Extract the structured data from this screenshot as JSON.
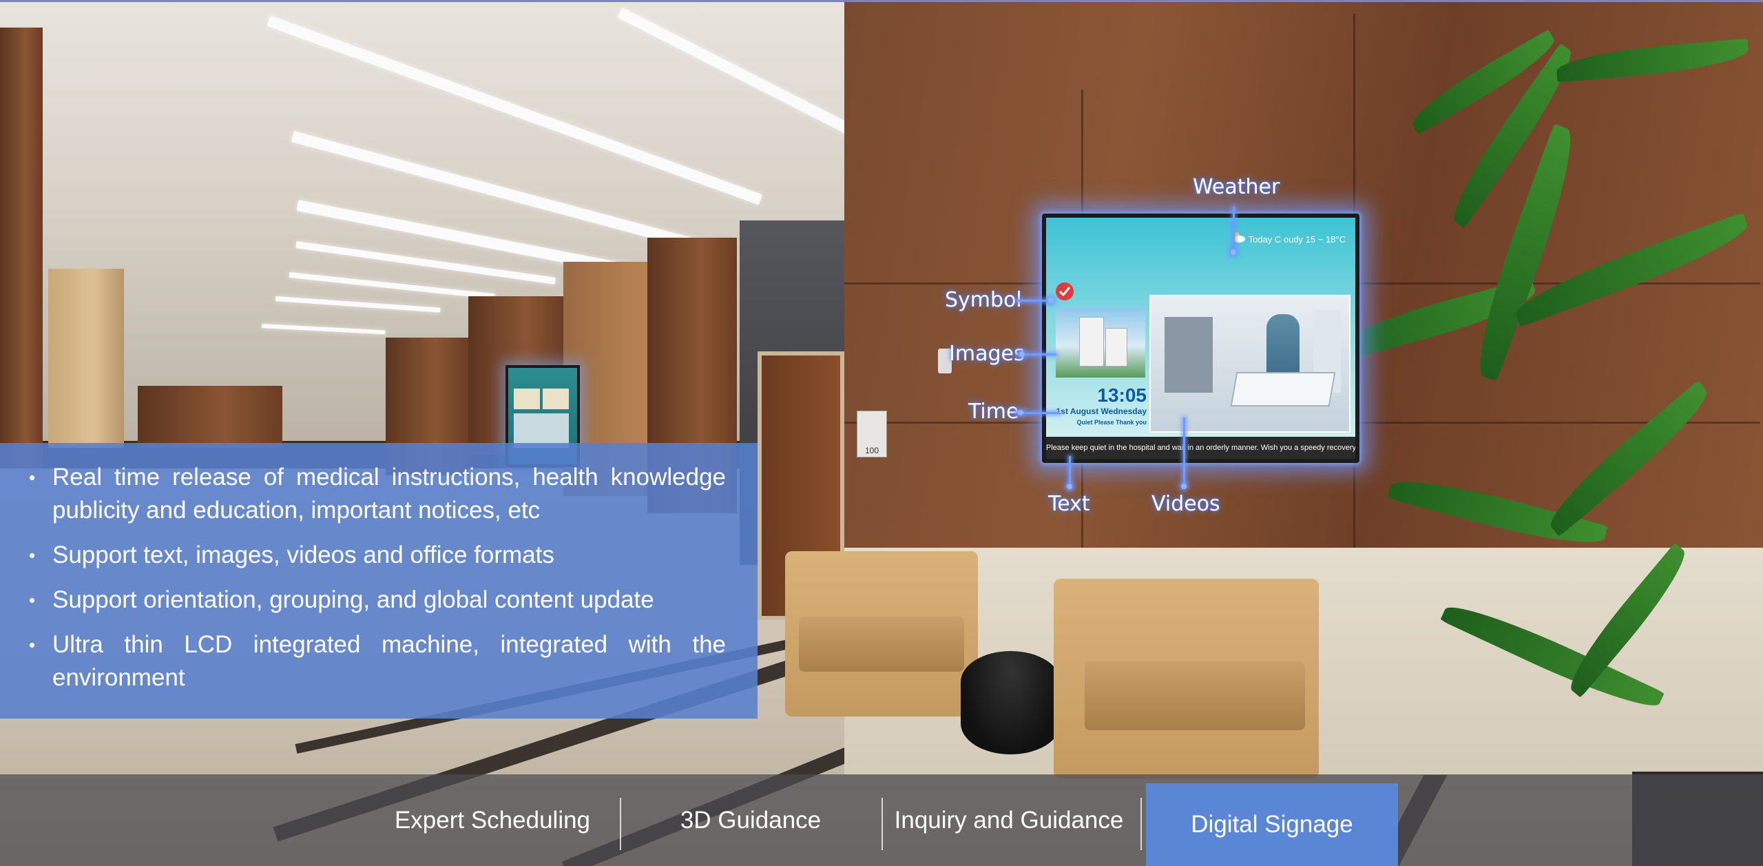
{
  "colors": {
    "panel_blue": "#5880ce",
    "active_tab_blue": "#5a86d6",
    "callout_glow": "#6e9cff",
    "nav_bar": "#4b4b50"
  },
  "signage": {
    "weather_text": "Today C oudy 15 ~ 18°C",
    "time": "13:05",
    "date": "1st August Wednesday",
    "quiet": "Quiet Please Thank you",
    "ticker": "Please keep quiet in the hospital and wait in an orderly manner. Wish you a speedy recovery."
  },
  "small_sign": "100",
  "callouts": {
    "weather": "Weather",
    "symbol": "Symbol",
    "images": "Images",
    "time": "Time",
    "text": "Text",
    "videos": "Videos"
  },
  "features": [
    "Real time release of medical instructions, health knowledge publicity and education, important notices, etc",
    "Support text, images, videos and office formats",
    "Support orientation, grouping, and global content update",
    "Ultra thin LCD integrated machine, integrated with the environment"
  ],
  "bullet_glyph": "•",
  "nav": {
    "tabs": [
      {
        "label": "Expert Scheduling",
        "active": false
      },
      {
        "label": "3D Guidance",
        "active": false
      },
      {
        "label": "Inquiry and Guidance",
        "active": false
      },
      {
        "label": "Digital Signage",
        "active": true
      }
    ]
  }
}
